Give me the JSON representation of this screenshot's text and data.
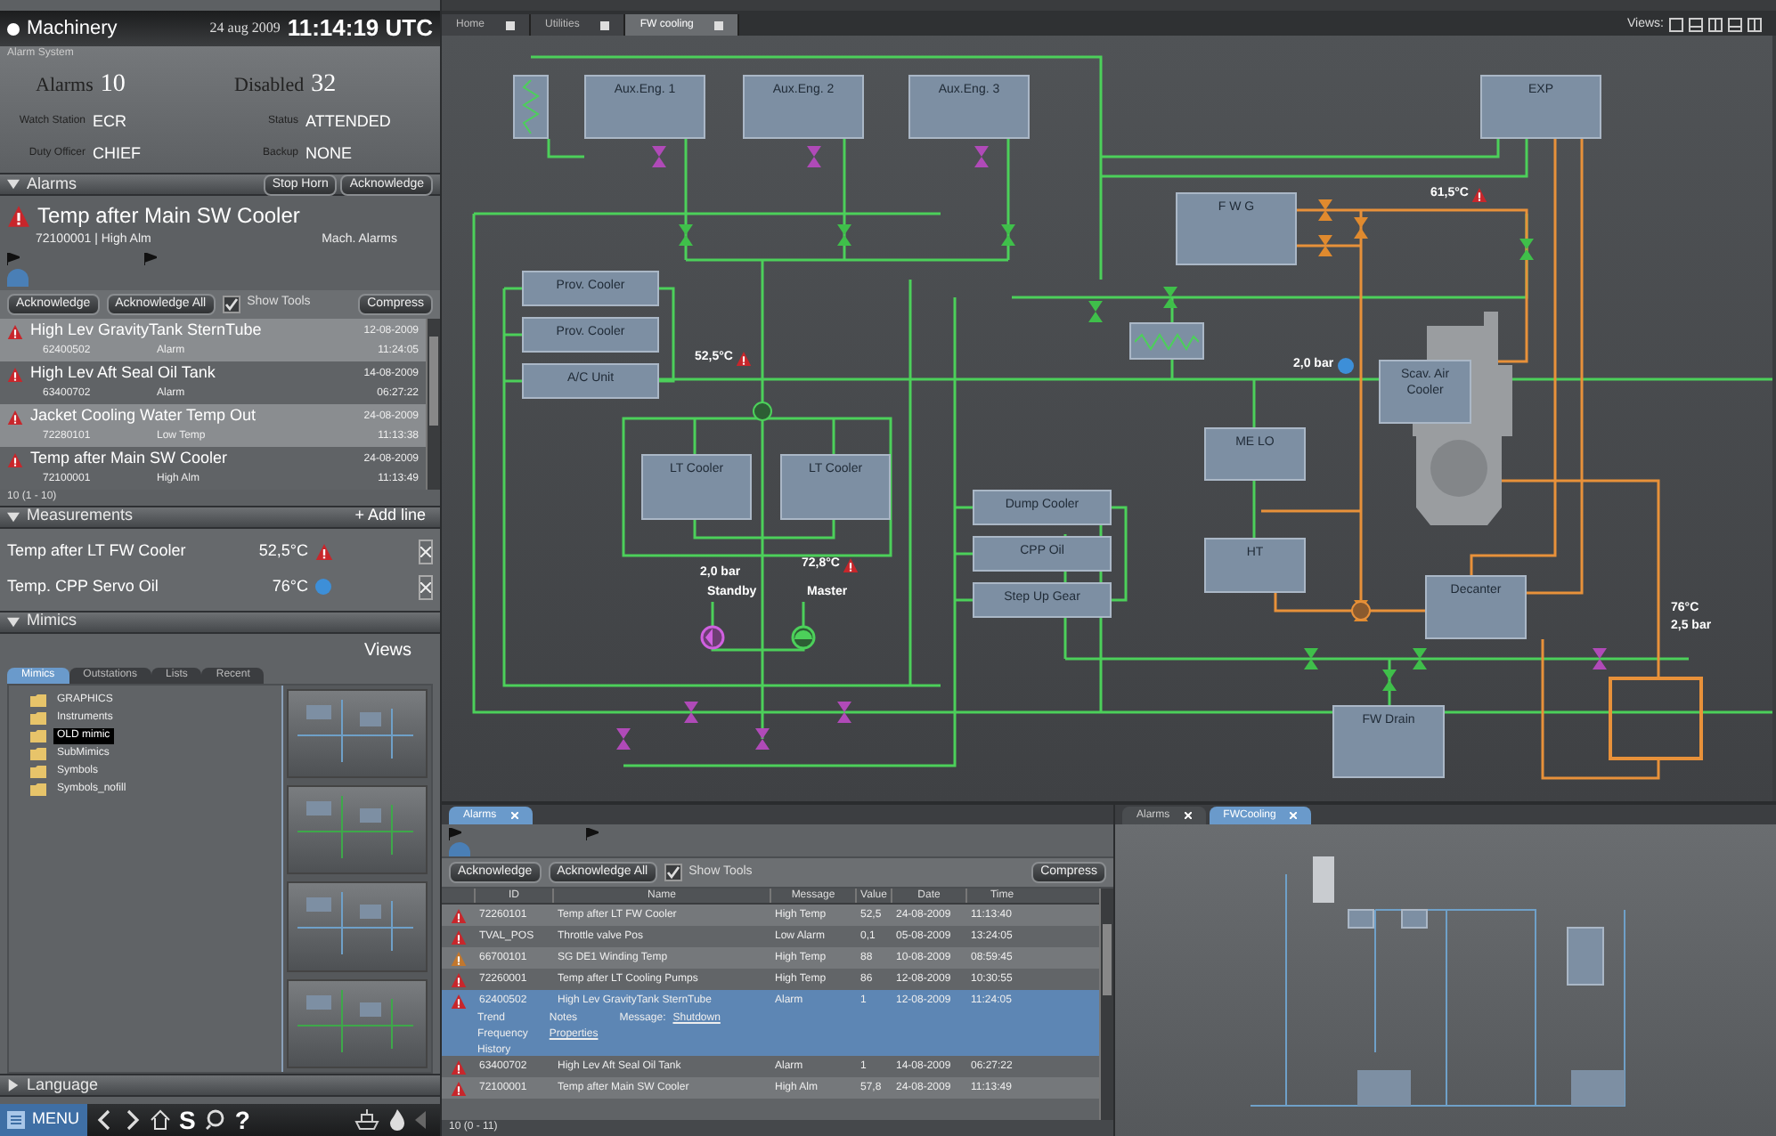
{
  "left_panel": {
    "header": {
      "title": "Machinery",
      "date": "24 aug 2009",
      "time": "11:14:19 UTC"
    },
    "alarm_system": {
      "label": "Alarm System",
      "alarms_label": "Alarms",
      "alarms_count": "10",
      "disabled_label": "Disabled",
      "disabled_count": "32",
      "fields": [
        {
          "label": "Watch Station",
          "value": "ECR"
        },
        {
          "label": "Status",
          "value": "ATTENDED"
        },
        {
          "label": "Duty Officer",
          "value": "CHIEF"
        },
        {
          "label": "Backup",
          "value": "NONE"
        }
      ]
    },
    "alarms": {
      "title": "Alarms",
      "expanded": true,
      "buttons": [
        "Stop Horn",
        "Acknowledge"
      ],
      "current": {
        "name": "Temp after Main SW Cooler",
        "detail": "72100001 | High Alm",
        "group": "Mach. Alarms"
      },
      "toolbar": {
        "buttons": [
          "Acknowledge",
          "Acknowledge All"
        ],
        "show_tools": {
          "label": "Show Tools",
          "checked": true
        },
        "compress": "Compress"
      },
      "list": [
        {
          "name": "High Lev GravityTank SternTube",
          "id": "62400502",
          "message": "Alarm",
          "date": "12-08-2009",
          "time": "11:24:05",
          "selected": true
        },
        {
          "name": "High Lev Aft Seal Oil Tank",
          "id": "63400702",
          "message": "Alarm",
          "date": "14-08-2009",
          "time": "06:27:22",
          "selected": false
        },
        {
          "name": "Jacket Cooling Water Temp Out",
          "id": "72280101",
          "message": "Low Temp",
          "date": "24-08-2009",
          "time": "11:13:38",
          "selected": true
        },
        {
          "name": "Temp after Main SW Cooler",
          "id": "72100001",
          "message": "High Alm",
          "date": "24-08-2009",
          "time": "11:13:49",
          "selected": false
        }
      ],
      "footer": "10 (1 - 10)"
    },
    "measurements": {
      "title": "Measurements",
      "expanded": true,
      "add": "+ Add line",
      "rows": [
        {
          "name": "Temp after LT FW Cooler",
          "value": "52,5°C",
          "kind": "alarm"
        },
        {
          "name": "Temp. CPP Servo Oil",
          "value": "76°C",
          "kind": "info"
        }
      ]
    },
    "mimics": {
      "title": "Mimics",
      "expanded": true,
      "views": "Views",
      "tabs": [
        {
          "label": "Mimics",
          "selected": true
        },
        {
          "label": "Outstations",
          "selected": false
        },
        {
          "label": "Lists",
          "selected": false
        },
        {
          "label": "Recent",
          "selected": false
        }
      ],
      "folders": [
        {
          "name": "GRAPHICS",
          "selected": false
        },
        {
          "name": "Instruments",
          "selected": false
        },
        {
          "name": "OLD mimic",
          "selected": true
        },
        {
          "name": "SubMimics",
          "selected": false
        },
        {
          "name": "Symbols",
          "selected": false
        },
        {
          "name": "Symbols_nofill",
          "selected": false
        }
      ]
    },
    "language": {
      "title": "Language",
      "expanded": false
    }
  },
  "taskbar": {
    "menu": "MENU",
    "s_key": "S",
    "help": "?"
  },
  "diagram_tabs": [
    {
      "label": "Home",
      "selected": false
    },
    {
      "label": "Utilities",
      "selected": false
    },
    {
      "label": "FW cooling",
      "selected": true
    }
  ],
  "views_label": "Views:",
  "diagram": {
    "nodes": [
      {
        "label": "Aux.Eng. 1"
      },
      {
        "label": "Aux.Eng. 2"
      },
      {
        "label": "Aux.Eng. 3"
      },
      {
        "label": "Prov. Cooler"
      },
      {
        "label": "Prov. Cooler"
      },
      {
        "label": "A/C Unit"
      },
      {
        "label": "LT Cooler"
      },
      {
        "label": "LT Cooler"
      },
      {
        "label": "Dump Cooler"
      },
      {
        "label": "CPP Oil"
      },
      {
        "label": "Step Up Gear"
      },
      {
        "label": "EXP"
      },
      {
        "label": "F W G"
      },
      {
        "label": "Scav. Air Cooler"
      },
      {
        "label": "ME LO"
      },
      {
        "label": "HT"
      },
      {
        "label": "Decanter"
      },
      {
        "label": "FW Drain"
      }
    ],
    "readings": [
      {
        "text": "52,5°C",
        "kind": "alarm"
      },
      {
        "text": "72,8°C",
        "kind": "alarm"
      },
      {
        "text": "2,0 bar",
        "kind": "plain"
      },
      {
        "text": "Standby",
        "kind": "plain"
      },
      {
        "text": "Master",
        "kind": "plain"
      },
      {
        "text": "61,5°C",
        "kind": "alarm"
      },
      {
        "text": "2,0 bar",
        "kind": "info"
      },
      {
        "text": "76°C",
        "kind": "plain"
      },
      {
        "text": "2,5 bar",
        "kind": "plain"
      }
    ]
  },
  "alarm_panel": {
    "tab": "Alarms",
    "toolbar": {
      "buttons": [
        "Acknowledge",
        "Acknowledge All"
      ],
      "show_tools": {
        "label": "Show Tools",
        "checked": true
      },
      "compress": "Compress"
    },
    "columns": [
      "ID",
      "Name",
      "Message",
      "Value",
      "Date",
      "Time"
    ],
    "rows": [
      {
        "cells": [
          "72260101",
          "Temp after LT FW Cooler",
          "High Temp",
          "52,5",
          "24-08-2009",
          "11:13:40"
        ],
        "color": "#c8262b",
        "selected": false
      },
      {
        "cells": [
          "TVAL_POS",
          "Throttle valve Pos",
          "Low Alarm",
          "0,1",
          "05-08-2009",
          "13:24:05"
        ],
        "color": "#c8262b",
        "selected": false
      },
      {
        "cells": [
          "66700101",
          "SG DE1 Winding Temp",
          "High Temp",
          "88",
          "10-08-2009",
          "08:59:45"
        ],
        "color": "#c2772d",
        "selected": false
      },
      {
        "cells": [
          "72260001",
          "Temp after LT Cooling Pumps",
          "High Temp",
          "86",
          "12-08-2009",
          "10:30:55"
        ],
        "color": "#c8262b",
        "selected": false
      },
      {
        "cells": [
          "62400502",
          "High Lev GravityTank SternTube",
          "Alarm",
          "1",
          "12-08-2009",
          "11:24:05"
        ],
        "color": "#c8262b",
        "selected": true,
        "details": {
          "items": [
            "Trend",
            "Frequency",
            "History"
          ],
          "notes": "Notes",
          "properties": "Properties",
          "message_label": "Message:",
          "message_link": "Shutdown"
        }
      },
      {
        "cells": [
          "63400702",
          "High Lev Aft Seal Oil Tank",
          "Alarm",
          "1",
          "14-08-2009",
          "06:27:22"
        ],
        "color": "#c8262b",
        "selected": false
      },
      {
        "cells": [
          "72100001",
          "Temp after Main SW Cooler",
          "High Alm",
          "57,8",
          "24-08-2009",
          "11:13:49"
        ],
        "color": "#c8262b",
        "selected": false
      }
    ],
    "footer": "10 (0 - 11)"
  },
  "mini_view": {
    "tabs": [
      {
        "label": "Alarms",
        "selected": false
      },
      {
        "label": "FWCooling",
        "selected": true
      }
    ]
  }
}
